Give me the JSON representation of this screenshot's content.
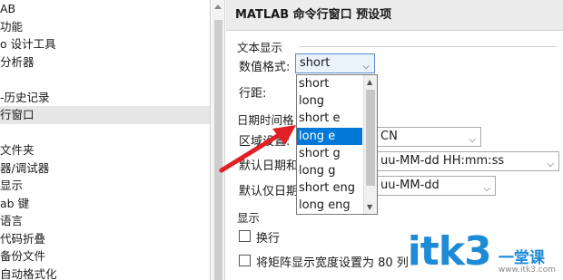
{
  "tree": {
    "items": [
      {
        "label": "AB",
        "selected": false
      },
      {
        "label": "功能",
        "selected": false
      },
      {
        "label": "o 设计工具",
        "selected": false
      },
      {
        "label": "分析器",
        "selected": false
      },
      {
        "label": "",
        "selected": false
      },
      {
        "label": "-历史记录",
        "selected": false
      },
      {
        "label": "行窗口",
        "selected": true
      },
      {
        "label": "",
        "selected": false
      },
      {
        "label": "文件夹",
        "selected": false
      },
      {
        "label": "器/调试器",
        "selected": false
      },
      {
        "label": "显示",
        "selected": false
      },
      {
        "label": "ab 键",
        "selected": false
      },
      {
        "label": "语言",
        "selected": false
      },
      {
        "label": "代码折叠",
        "selected": false
      },
      {
        "label": "备份文件",
        "selected": false
      },
      {
        "label": "自动格式化",
        "selected": false
      }
    ]
  },
  "panel": {
    "title": "MATLAB 命令行窗口 预设项",
    "text_display_section": "文本显示",
    "numeric_format_label": "数值格式:",
    "numeric_format_value": "short",
    "line_spacing_label": "行距:",
    "datetime_section": "日期时间格",
    "locale_label": "区域设置:",
    "locale_value": "CN",
    "default_datetime_label": "默认日期和",
    "default_datetime_value": "uu-MM-dd HH:mm:ss",
    "default_date_label": "默认仅日期",
    "default_date_value": "uu-MM-dd",
    "display_section": "显示",
    "wrap_label": "换行",
    "matrix_width_label": "将矩阵显示宽度设置为 80 列"
  },
  "dropdown": {
    "options": [
      "short",
      "long",
      "short e",
      "long e",
      "short g",
      "long g",
      "short eng",
      "long eng"
    ],
    "highlighted_index": 3
  },
  "watermark": {
    "big": "itk3",
    "cn": "一堂课",
    "url": "www.itk3.com"
  },
  "colors": {
    "highlight": "#0078d7",
    "arrow": "#e01f26",
    "watermark": "#1e8bd6"
  }
}
